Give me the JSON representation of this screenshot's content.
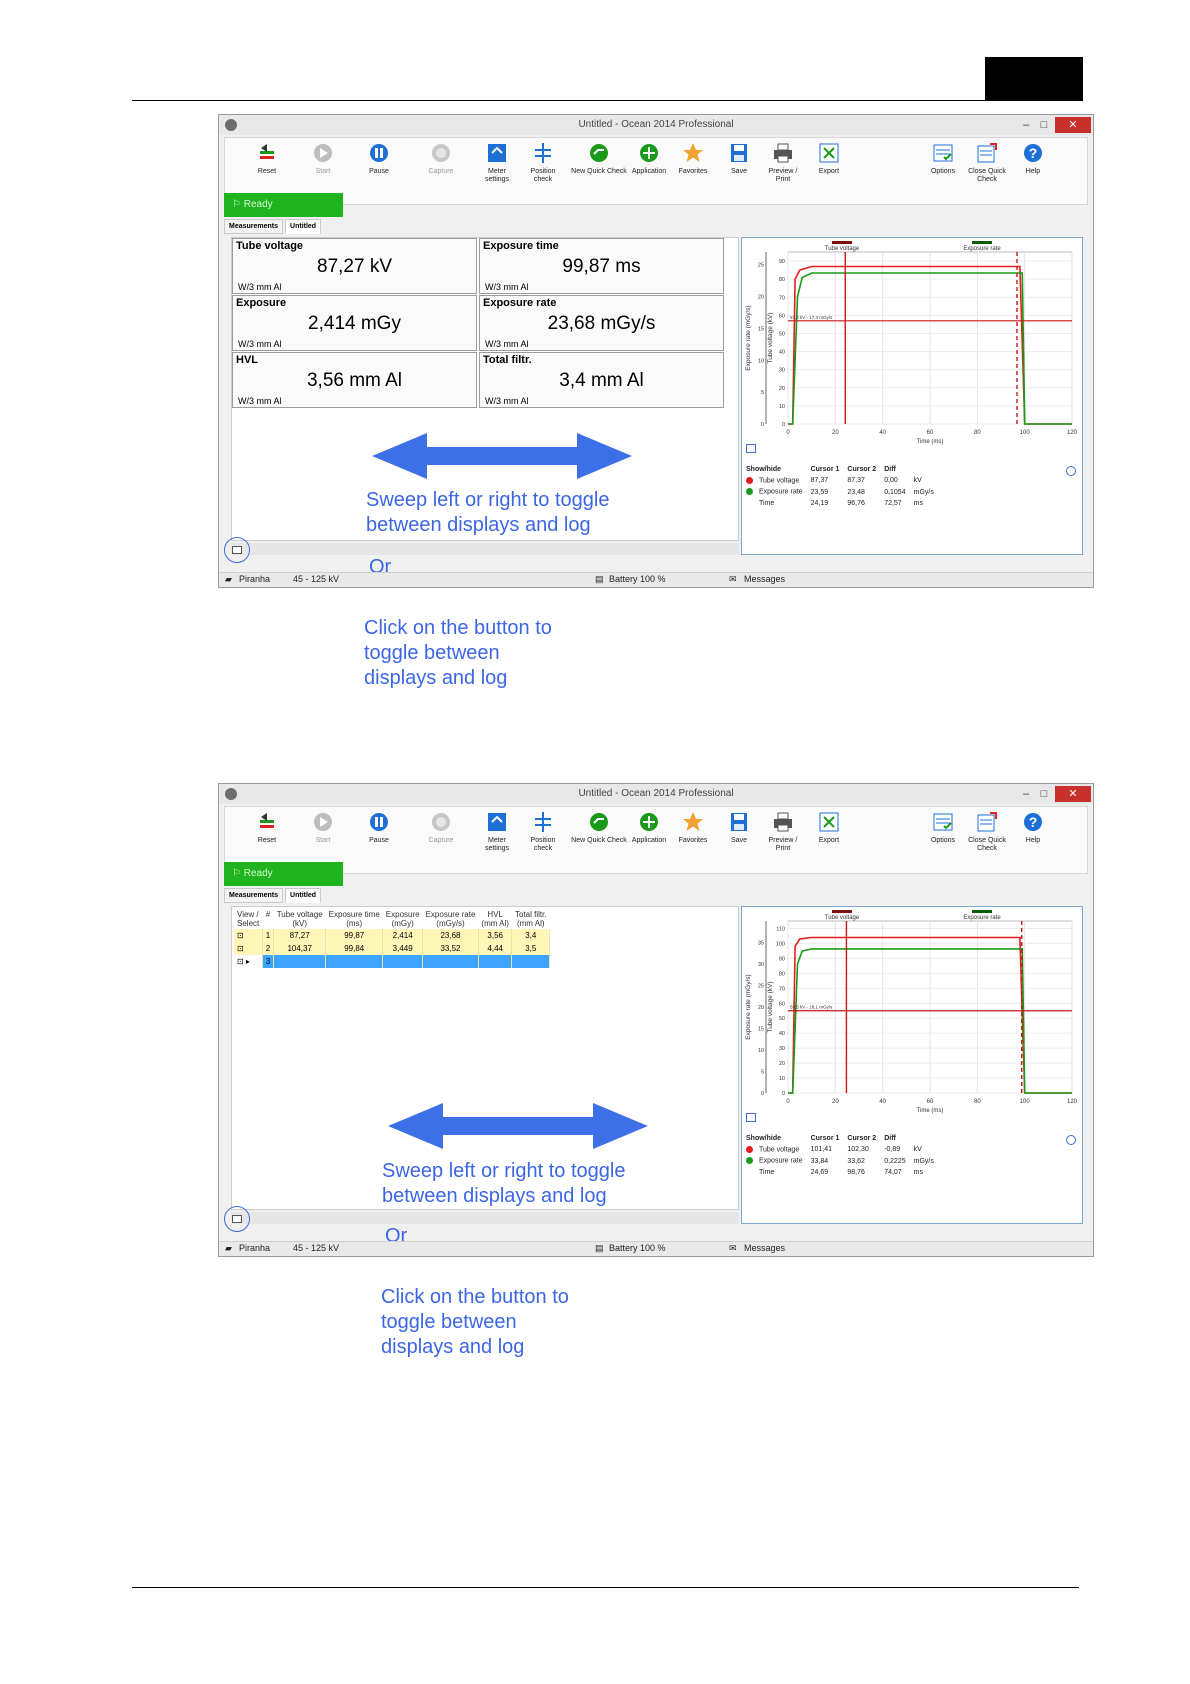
{
  "app": {
    "title": "Untitled - Ocean 2014 Professional",
    "toolbar": [
      {
        "label": "Reset",
        "icon": "reset-icon"
      },
      {
        "label": "Start",
        "icon": "play-icon",
        "disabled": true
      },
      {
        "label": "Pause",
        "icon": "pause-icon"
      },
      {
        "label": "Capture",
        "icon": "capture-icon",
        "disabled": true
      },
      {
        "label": "Meter\nsettings",
        "icon": "meter-settings-icon"
      },
      {
        "label": "Position\ncheck",
        "icon": "position-check-icon"
      },
      {
        "label": "New Quick Check",
        "icon": "new-quick-check-icon"
      },
      {
        "label": "Application",
        "icon": "add-application-icon"
      },
      {
        "label": "Favorites",
        "icon": "star-icon"
      },
      {
        "label": "Save",
        "icon": "save-icon"
      },
      {
        "label": "Preview /\nPrint",
        "icon": "print-icon"
      },
      {
        "label": "Export",
        "icon": "export-icon"
      },
      {
        "label": "Options",
        "icon": "options-icon"
      },
      {
        "label": "Close Quick\nCheck",
        "icon": "close-quick-check-icon"
      },
      {
        "label": "Help",
        "icon": "help-icon"
      }
    ],
    "status": "Ready",
    "tabs": [
      "Measurements",
      "Untitled"
    ],
    "bottom": {
      "probe": "Piranha",
      "range": "45 - 125 kV",
      "battery": "Battery 100 %",
      "messages": "Messages"
    },
    "window_buttons": {
      "min": "–",
      "max": "□",
      "close": "✕"
    }
  },
  "display": {
    "cells": [
      {
        "title": "Tube voltage",
        "value": "87,27 kV",
        "sub": "W/3 mm Al"
      },
      {
        "title": "Exposure time",
        "value": "99,87 ms",
        "sub": "W/3 mm Al"
      },
      {
        "title": "Exposure",
        "value": "2,414 mGy",
        "sub": "W/3 mm Al"
      },
      {
        "title": "Exposure rate",
        "value": "23,68 mGy/s",
        "sub": "W/3 mm Al"
      },
      {
        "title": "HVL",
        "value": "3,56 mm Al",
        "sub": "W/3 mm Al"
      },
      {
        "title": "Total filtr.",
        "value": "3,4 mm Al",
        "sub": "W/3 mm Al"
      }
    ]
  },
  "log": {
    "headers": [
      "View /\nSelect",
      "#",
      "Tube voltage\n(kV)",
      "Exposure time\n(ms)",
      "Exposure\n(mGy)",
      "Exposure rate\n(mGy/s)",
      "HVL\n(mm Al)",
      "Total filtr.\n(mm Al)"
    ],
    "rows": [
      [
        "",
        "1",
        "87,27",
        "99,87",
        "2,414",
        "23,68",
        "3,56",
        "3,4"
      ],
      [
        "",
        "2",
        "104,37",
        "99,84",
        "3,449",
        "33,52",
        "4,44",
        "3,5"
      ],
      [
        "",
        "3",
        "",
        "",
        "",
        "",
        "",
        ""
      ]
    ]
  },
  "annotation": {
    "sweep": "Sweep left or right to toggle\nbetween displays and log",
    "or": "Or",
    "click": "Click on the button to\ntoggle between\ndisplays and log"
  },
  "colors": {
    "tube_voltage": "#e41e1e",
    "exposure_rate": "#1a9a1a",
    "annotation": "#3c66e6",
    "arrow": "#3d6fe6"
  },
  "chart_data": [
    {
      "type": "line",
      "legend": [
        "Tube voltage",
        "Exposure rate"
      ],
      "xlabel": "Time (ms)",
      "ylabel_left": "Exposure rate (mGy/s)",
      "ylabel_right": "Tube voltage (kV)",
      "xlim": [
        0,
        120
      ],
      "x_ticks": [
        "0",
        "20",
        "40",
        "60",
        "80",
        "100",
        "120"
      ],
      "y_kv_ticks": [
        "0",
        "10",
        "20",
        "30",
        "40",
        "50",
        "60",
        "70",
        "80",
        "90"
      ],
      "y_rate_ticks": [
        "0",
        "5",
        "10",
        "15",
        "20",
        "25"
      ],
      "ylim_kv": [
        0,
        95
      ],
      "ylim_rate": [
        0,
        27
      ],
      "series": [
        {
          "name": "Tube voltage",
          "x": [
            0,
            2,
            3,
            5,
            10,
            20,
            40,
            60,
            80,
            97,
            98,
            100,
            120
          ],
          "y": [
            0,
            0,
            80,
            85,
            87,
            87,
            87,
            87,
            87,
            87,
            87,
            0,
            0
          ]
        },
        {
          "name": "Exposure rate",
          "x": [
            0,
            2,
            4,
            6,
            10,
            20,
            40,
            60,
            80,
            98,
            99,
            100,
            120
          ],
          "y": [
            0,
            0,
            20,
            23,
            23.7,
            23.7,
            23.7,
            23.7,
            23.7,
            23.7,
            23.7,
            0,
            0
          ]
        }
      ],
      "cursor1_x": 24.19,
      "cursor2_x": 96.76,
      "hline_kv": 57,
      "cursor_label": "57,2 kV - 17,3 mGy/s",
      "cursor_table": {
        "headers": [
          "Show/hide",
          "Cursor 1",
          "Cursor 2",
          "Diff",
          ""
        ],
        "rows": [
          [
            "Tube voltage",
            "87,37",
            "87,37",
            "0,00",
            "kV"
          ],
          [
            "Exposure rate",
            "23,59",
            "23,48",
            "0,1054",
            "mGy/s"
          ],
          [
            "Time",
            "24,19",
            "96,76",
            "72,57",
            "ms"
          ]
        ]
      }
    },
    {
      "type": "line",
      "legend": [
        "Tube voltage",
        "Exposure rate"
      ],
      "xlabel": "Time (ms)",
      "ylabel_left": "Exposure rate (mGy/s)",
      "ylabel_right": "Tube voltage (kV)",
      "xlim": [
        0,
        120
      ],
      "x_ticks": [
        "0",
        "20",
        "40",
        "60",
        "80",
        "100",
        "120"
      ],
      "y_kv_ticks": [
        "0",
        "10",
        "20",
        "30",
        "40",
        "50",
        "60",
        "70",
        "80",
        "90",
        "100",
        "110"
      ],
      "y_rate_ticks": [
        "0",
        "5",
        "10",
        "15",
        "20",
        "25",
        "30",
        "35"
      ],
      "ylim_kv": [
        0,
        115
      ],
      "ylim_rate": [
        0,
        40
      ],
      "series": [
        {
          "name": "Tube voltage",
          "x": [
            0,
            2,
            3,
            5,
            10,
            20,
            40,
            60,
            80,
            97,
            98,
            100,
            120
          ],
          "y": [
            0,
            0,
            98,
            103,
            104,
            104,
            104,
            104,
            104,
            104,
            104,
            0,
            0
          ]
        },
        {
          "name": "Exposure rate",
          "x": [
            0,
            2,
            4,
            6,
            10,
            20,
            40,
            60,
            80,
            98,
            99,
            100,
            120
          ],
          "y": [
            0,
            0,
            30,
            33,
            33.5,
            33.5,
            33.5,
            33.5,
            33.5,
            33.5,
            33.5,
            0,
            0
          ]
        }
      ],
      "cursor1_x": 24.69,
      "cursor2_x": 98.76,
      "hline_kv": 55,
      "cursor_label": "55,5 kV - 18,1 mGy/s",
      "cursor_table": {
        "headers": [
          "Show/hide",
          "Cursor 1",
          "Cursor 2",
          "Diff",
          ""
        ],
        "rows": [
          [
            "Tube voltage",
            "101,41",
            "102,30",
            "-0,89",
            "kV"
          ],
          [
            "Exposure rate",
            "33,84",
            "33,62",
            "0,2225",
            "mGy/s"
          ],
          [
            "Time",
            "24,69",
            "98,76",
            "74,07",
            "ms"
          ]
        ]
      }
    }
  ]
}
